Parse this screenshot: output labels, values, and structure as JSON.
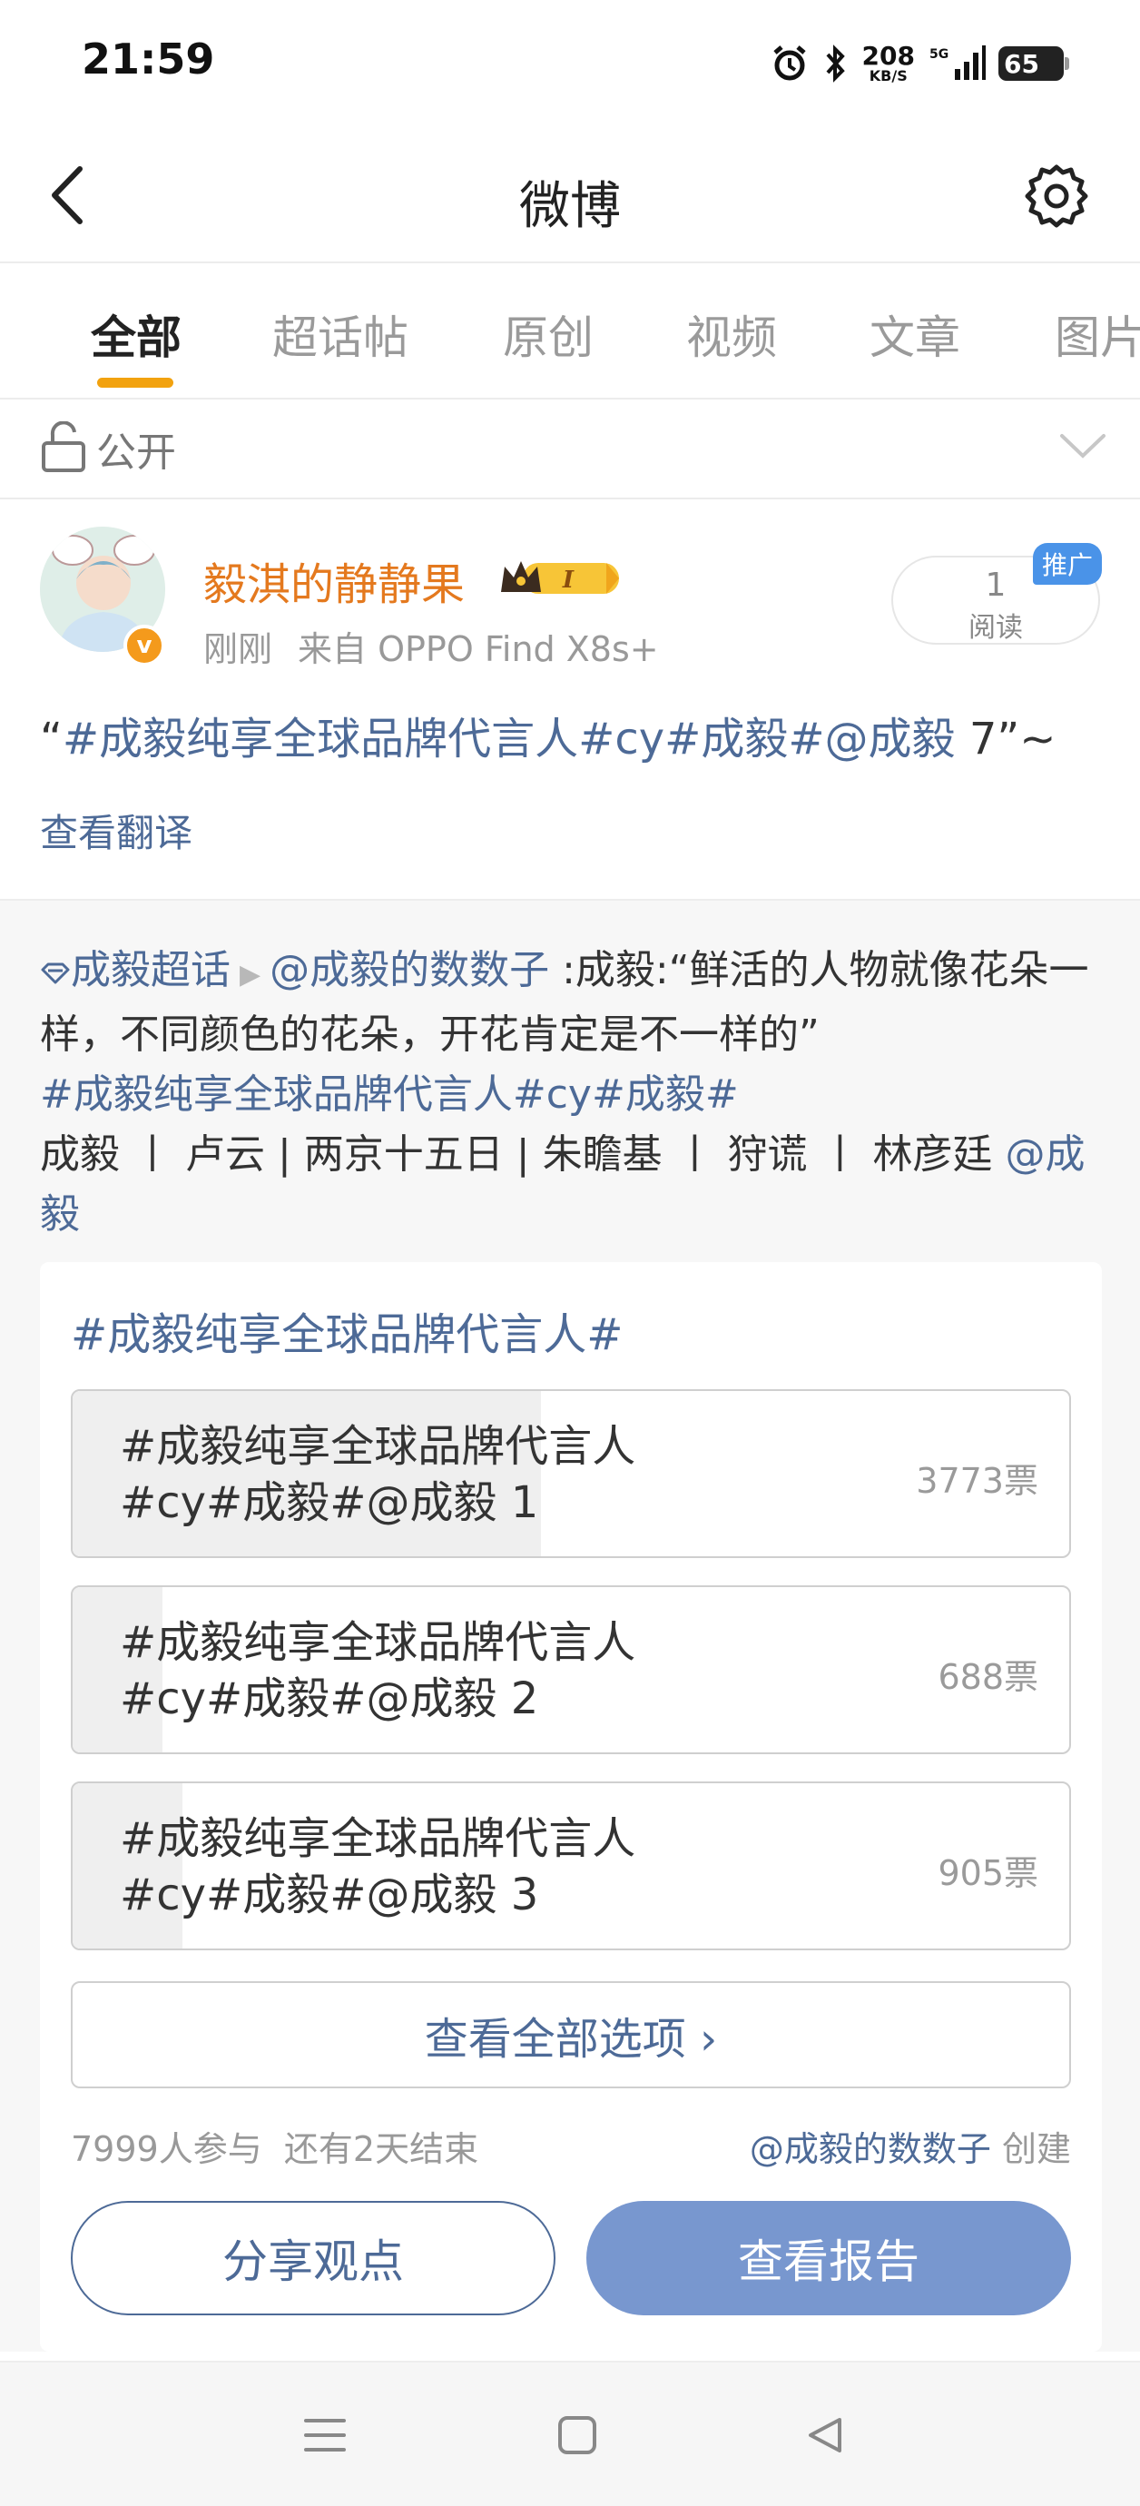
{
  "status_bar": {
    "time": "21:59",
    "speed_value": "208",
    "speed_unit": "KB/S",
    "network": "5G",
    "battery": "65"
  },
  "header": {
    "title": "微博"
  },
  "tabs": [
    {
      "label": "全部",
      "active": true
    },
    {
      "label": "超话帖"
    },
    {
      "label": "原创"
    },
    {
      "label": "视频"
    },
    {
      "label": "文章"
    },
    {
      "label": "图片"
    }
  ],
  "visibility": {
    "label": "公开"
  },
  "post": {
    "username": "毅淇的静静果",
    "time": "刚刚",
    "source": "来自 OPPO Find X8s+",
    "reads_count": "1",
    "reads_label": "阅读",
    "promote_label": "推广",
    "text_open": "“",
    "text_topic": "#成毅纯享全球品牌代言人#cy#成毅#@成毅",
    "text_tail": " 7”~",
    "translate_link": "查看翻译"
  },
  "repost": {
    "supertopic": "成毅超话",
    "author": "@成毅的数数子",
    "text_a": " :成毅:“鲜活的人物就像花朵一样，不同颜色的花朵，开花肯定是不一样的”",
    "topic": "#成毅纯享全球品牌代言人#cy#成毅#",
    "text_b": "成毅 丨 卢云 | 两京十五日 | 朱瞻基 丨 狩谎 丨 林彦廷 ",
    "mention": "@成毅"
  },
  "poll": {
    "title": "#成毅纯享全球品牌代言人#",
    "options": [
      {
        "line1": "#成毅纯享全球品牌代言人",
        "line2": "#cy#成毅#@成毅 1",
        "votes": "3773票",
        "share": 0.47
      },
      {
        "line1": "#成毅纯享全球品牌代言人",
        "line2": "#cy#成毅#@成毅 2",
        "votes": "688票",
        "share": 0.09
      },
      {
        "line1": "#成毅纯享全球品牌代言人",
        "line2": "#cy#成毅#@成毅 3",
        "votes": "905票",
        "share": 0.11
      }
    ],
    "view_all": "查看全部选项 ›",
    "participants": "7999人参与",
    "remaining": "还有2天结束",
    "creator": "@成毅的数数子",
    "creator_suffix": " 创建",
    "share_button": "分享观点",
    "report_button": "查看报告"
  },
  "colors": {
    "link": "#4d6a97",
    "username": "#e4791e",
    "tab_indicator": "#f2a20f",
    "report_button": "#7897cf"
  },
  "icons": [
    "back-icon",
    "settings-icon",
    "lock-open-icon",
    "chevron-down-icon",
    "diamond-icon",
    "menu-icon",
    "square-icon",
    "triangle-back-icon"
  ]
}
